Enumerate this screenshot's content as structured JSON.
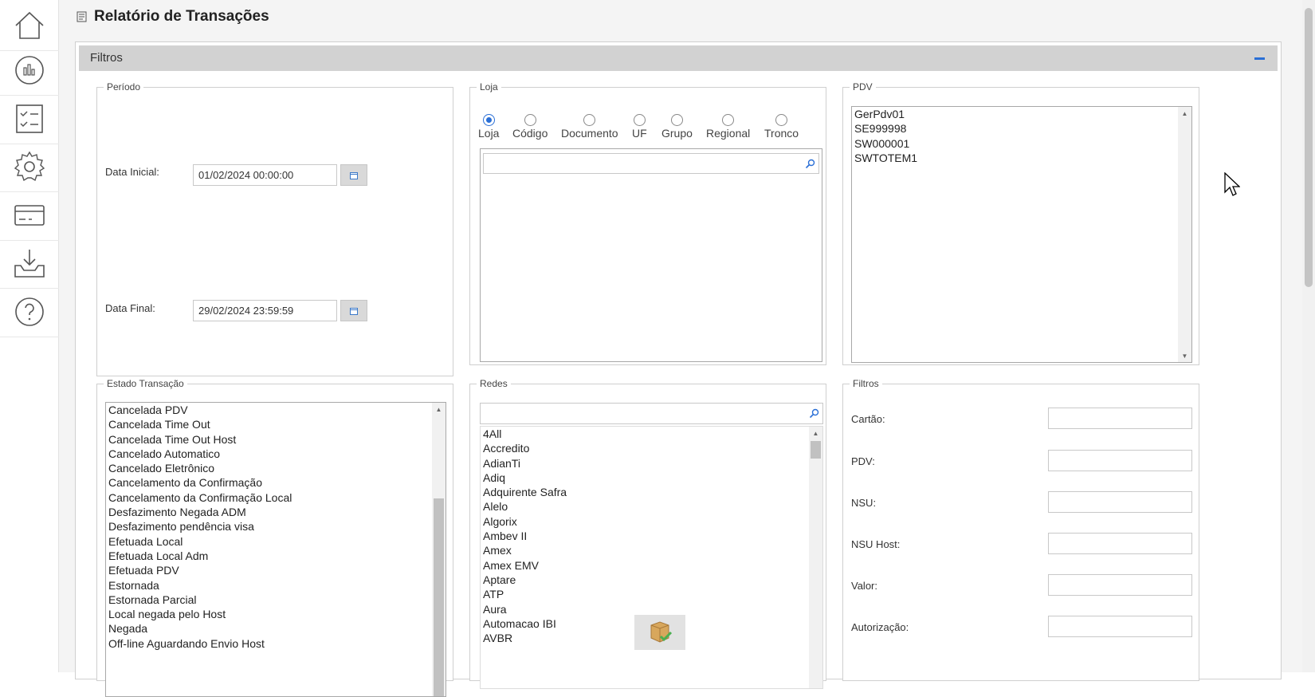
{
  "sidebar": {
    "items": [
      {
        "name": "home-icon"
      },
      {
        "name": "chart-icon"
      },
      {
        "name": "checklist-icon"
      },
      {
        "name": "gear-icon"
      },
      {
        "name": "card-icon"
      },
      {
        "name": "download-tray-icon"
      },
      {
        "name": "help-icon"
      }
    ]
  },
  "page": {
    "title": "Relatório de Transações"
  },
  "filters_panel": {
    "title": "Filtros"
  },
  "periodo": {
    "legend": "Período",
    "data_inicial_label": "Data Inicial:",
    "data_inicial_value": "01/02/2024 00:00:00",
    "data_final_label": "Data Final:",
    "data_final_value": "29/02/2024 23:59:59"
  },
  "loja": {
    "legend": "Loja",
    "options": [
      "Loja",
      "Código",
      "Documento",
      "UF",
      "Grupo",
      "Regional",
      "Tronco"
    ],
    "selected": "Loja",
    "search_value": ""
  },
  "pdv": {
    "legend": "PDV",
    "items": [
      "GerPdv01",
      "SE999998",
      "SW000001",
      "SWTOTEM1"
    ]
  },
  "estado_transacao": {
    "legend": "Estado Transação",
    "items": [
      "Cancelada PDV",
      "Cancelada Time Out",
      "Cancelada Time Out Host",
      "Cancelado Automatico",
      "Cancelado Eletrônico",
      "Cancelamento da Confirmação",
      "Cancelamento da Confirmação Local",
      "Desfazimento Negada ADM",
      "Desfazimento pendência visa",
      "Efetuada Local",
      "Efetuada Local Adm",
      "Efetuada PDV",
      "Estornada",
      "Estornada Parcial",
      "Local negada pelo Host",
      "Negada",
      "Off-line Aguardando Envio Host"
    ]
  },
  "redes": {
    "legend": "Redes",
    "search_value": "",
    "items": [
      "4All",
      "Accredito",
      "AdianTi",
      "Adiq",
      "Adquirente Safra",
      "Alelo",
      "Algorix",
      "Ambev II",
      "Amex",
      "Amex EMV",
      "Aptare",
      "ATP",
      "Aura",
      "Automacao IBI",
      "AVBR"
    ]
  },
  "filtros_box": {
    "legend": "Filtros",
    "fields": [
      {
        "label": "Cartão:",
        "value": ""
      },
      {
        "label": "PDV:",
        "value": ""
      },
      {
        "label": "NSU:",
        "value": ""
      },
      {
        "label": "NSU Host:",
        "value": ""
      },
      {
        "label": "Valor:",
        "value": ""
      },
      {
        "label": "Autorização:",
        "value": ""
      }
    ]
  },
  "colors": {
    "accent": "#2a6fd6",
    "panel_header": "#d2d2d2",
    "background": "#f4f4f4"
  }
}
